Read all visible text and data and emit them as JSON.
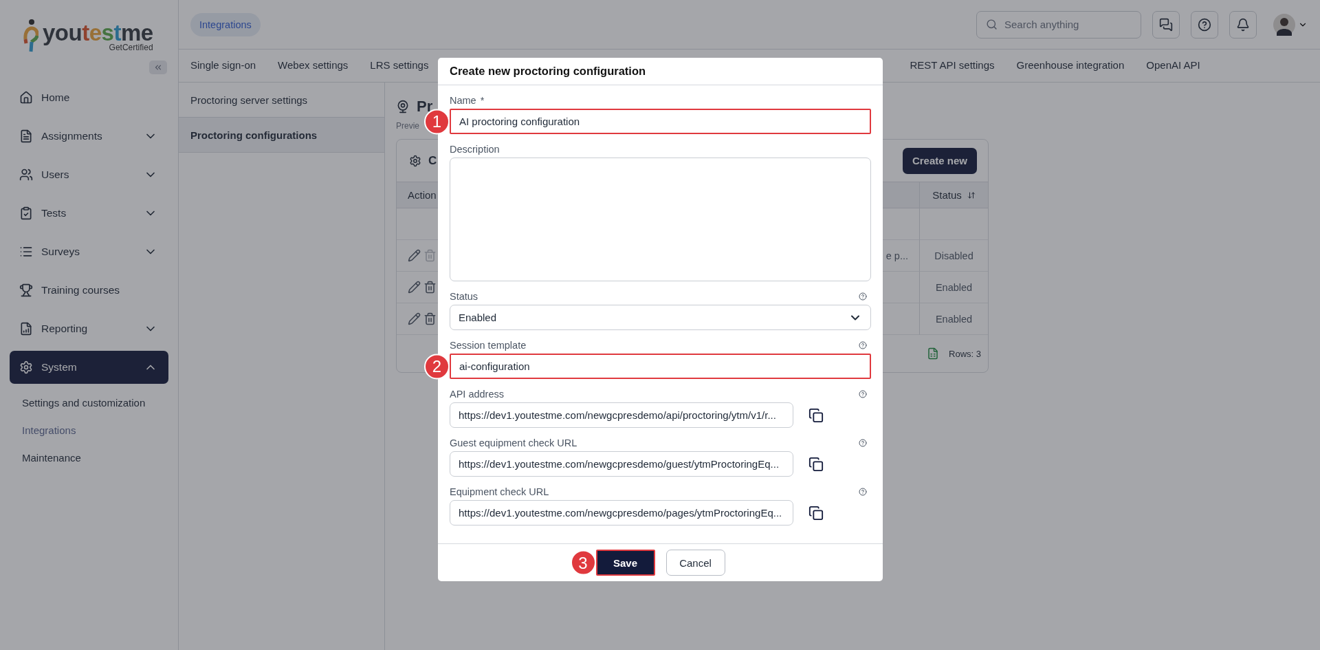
{
  "sidebar": {
    "logo": {
      "segments": [
        "you",
        "t",
        "e",
        "s",
        "t",
        "me"
      ],
      "tagline": "GetCertified"
    },
    "items": [
      {
        "kind": "link",
        "label": "Home",
        "selected": false
      },
      {
        "kind": "group",
        "label": "Assignments",
        "expanded": false,
        "selected": false
      },
      {
        "kind": "group",
        "label": "Users",
        "expanded": false,
        "selected": false
      },
      {
        "kind": "group",
        "label": "Tests",
        "expanded": false,
        "selected": false
      },
      {
        "kind": "group",
        "label": "Surveys",
        "expanded": false,
        "selected": false
      },
      {
        "kind": "link",
        "label": "Training courses",
        "selected": false
      },
      {
        "kind": "group",
        "label": "Reporting",
        "expanded": false,
        "selected": false
      },
      {
        "kind": "group",
        "label": "System",
        "expanded": true,
        "selected": true,
        "children": [
          {
            "label": "Settings and customization",
            "selected": false
          },
          {
            "label": "Integrations",
            "selected": true
          },
          {
            "label": "Maintenance",
            "selected": false
          }
        ]
      }
    ]
  },
  "topbar": {
    "breadcrumb": "Integrations",
    "search": {
      "placeholder": "Search anything"
    }
  },
  "tabs": {
    "leading": [
      {
        "label": "Single sign-on",
        "selected": false
      },
      {
        "label": "Webex settings",
        "selected": false
      },
      {
        "label": "LRS settings",
        "selected": false
      }
    ],
    "trailing": [
      {
        "label": "REST API settings",
        "selected": false
      },
      {
        "label": "Greenhouse integration",
        "selected": false
      },
      {
        "label": "OpenAI API",
        "selected": false
      }
    ]
  },
  "subnav": [
    {
      "label": "Proctoring server settings",
      "selected": false
    },
    {
      "label": "Proctoring configurations",
      "selected": true
    }
  ],
  "page": {
    "title": "Pr",
    "subtitle": "Previe",
    "card": {
      "title": "C",
      "create_button": "Create new",
      "columns": [
        {
          "kind": "plain",
          "label": "Action"
        },
        {
          "kind": "sortable",
          "label": "Status"
        }
      ],
      "rows": [
        {
          "column_3": "e p...",
          "status": "Disabled",
          "delete_disabled": true
        },
        {
          "status": "Enabled",
          "delete_disabled": false
        },
        {
          "status": "Enabled",
          "delete_disabled": false
        }
      ],
      "row_count": "Rows: 3"
    }
  },
  "dialog": {
    "title": "Create new proctoring configuration",
    "fields": [
      {
        "kind": "text",
        "label": "Name",
        "required_mark": "*",
        "help": false,
        "value": "AI proctoring configuration",
        "highlighted": true,
        "step": "1"
      },
      {
        "kind": "textarea",
        "label": "Description",
        "help": false,
        "highlighted": false
      },
      {
        "kind": "select",
        "label": "Status",
        "help": true,
        "value": "Enabled",
        "highlighted": false
      },
      {
        "kind": "text",
        "label": "Session template",
        "help": true,
        "value": "ai-configuration",
        "highlighted": true,
        "step": "2"
      },
      {
        "kind": "copy",
        "label": "API address",
        "help": true,
        "value": "https://dev1.youtestme.com/newgcpresdemo/api/proctoring/ytm/v1/r...",
        "highlighted": false
      },
      {
        "kind": "copy",
        "label": "Guest equipment check URL",
        "help": true,
        "value": "https://dev1.youtestme.com/newgcpresdemo/guest/ytmProctoringEq...",
        "highlighted": false
      },
      {
        "kind": "copy",
        "label": "Equipment check URL",
        "help": true,
        "value": "https://dev1.youtestme.com/newgcpresdemo/pages/ytmProctoringEq...",
        "highlighted": false
      }
    ],
    "buttons": [
      {
        "kind": "primary",
        "label": "Save",
        "highlighted": true,
        "step": "3"
      },
      {
        "kind": "secondary",
        "label": "Cancel",
        "highlighted": false
      }
    ]
  }
}
